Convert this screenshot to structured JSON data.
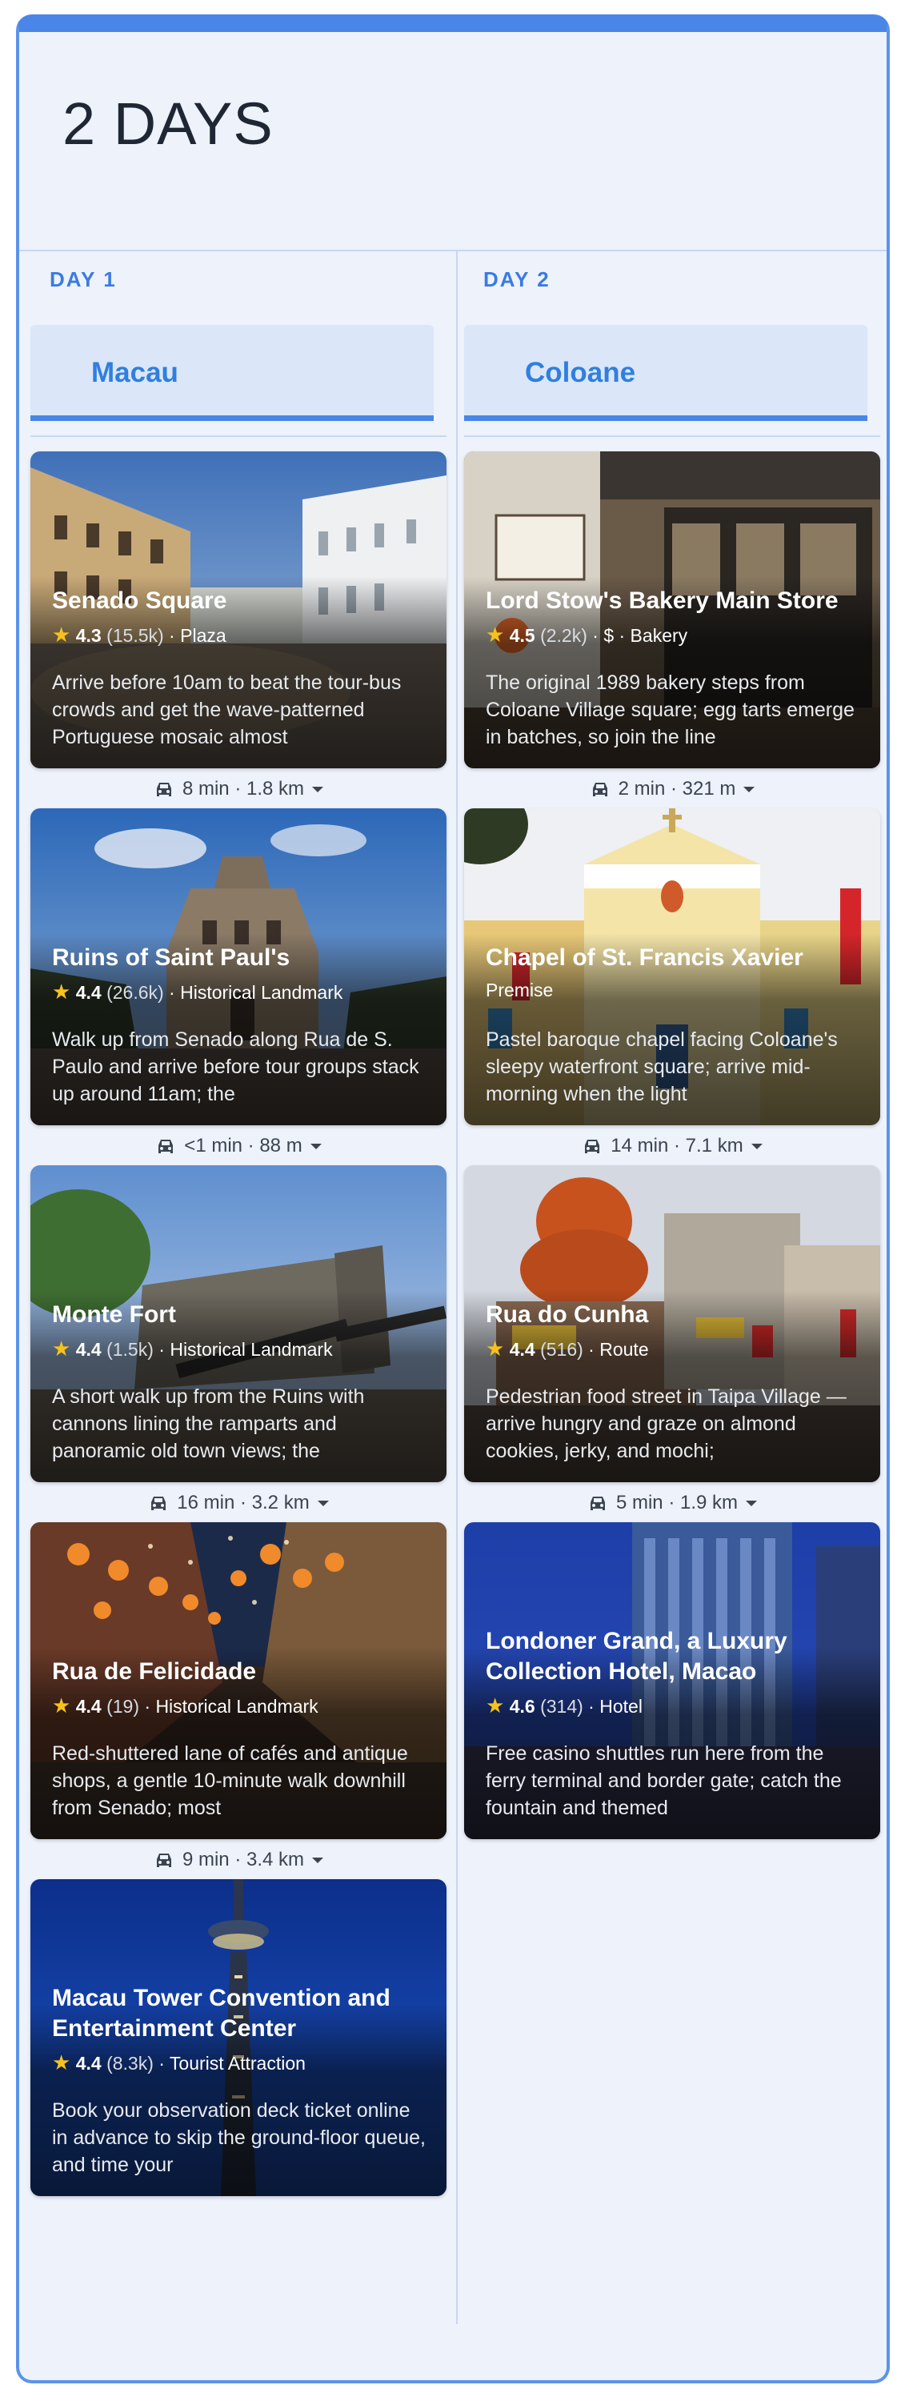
{
  "title": "2 DAYS",
  "days": [
    {
      "label": "DAY 1",
      "location": "Macau",
      "places": [
        {
          "name": "Senado Square",
          "rating": "4.3",
          "count": "(15.5k)",
          "type": "Plaza",
          "desc": "Arrive before 10am to beat the tour-bus crowds and get the wave-patterned Portuguese mosaic almost",
          "travel": "8 min · 1.8 km"
        },
        {
          "name": "Ruins of Saint Paul's",
          "rating": "4.4",
          "count": "(26.6k)",
          "type": "Historical Landmark",
          "desc": "Walk up from Senado along Rua de S. Paulo and arrive before tour groups stack up around 11am; the",
          "travel": "<1 min · 88 m"
        },
        {
          "name": "Monte Fort",
          "rating": "4.4",
          "count": "(1.5k)",
          "type": "Historical Landmark",
          "desc": "A short walk up from the Ruins with cannons lining the ramparts and panoramic old town views; the",
          "travel": "16 min · 3.2 km"
        },
        {
          "name": "Rua de Felicidade",
          "rating": "4.4",
          "count": "(19)",
          "type": "Historical Landmark",
          "desc": "Red-shuttered lane of cafés and antique shops, a gentle 10-minute walk downhill from Senado; most",
          "travel": "9 min · 3.4 km"
        },
        {
          "name": "Macau Tower Convention and Entertainment Center",
          "rating": "4.4",
          "count": "(8.3k)",
          "type": "Tourist Attraction",
          "desc": "Book your observation deck ticket online in advance to skip the ground-floor queue, and time your",
          "travel": ""
        }
      ]
    },
    {
      "label": "DAY 2",
      "location": "Coloane",
      "places": [
        {
          "name": "Lord Stow's Bakery Main Store",
          "rating": "4.5",
          "count": "(2.2k)",
          "type": "$ · Bakery",
          "desc": "The original 1989 bakery steps from Coloane Village square; egg tarts emerge in batches, so join the line",
          "travel": "2 min · 321 m"
        },
        {
          "name": "Chapel of St. Francis Xavier",
          "rating": "",
          "count": "",
          "type": "Premise",
          "desc": "Pastel baroque chapel facing Coloane's sleepy waterfront square; arrive mid-morning when the light",
          "travel": "14 min · 7.1 km"
        },
        {
          "name": "Rua do Cunha",
          "rating": "4.4",
          "count": "(516)",
          "type": "Route",
          "desc": "Pedestrian food street in Taipa Village — arrive hungry and graze on almond cookies, jerky, and mochi;",
          "travel": "5 min · 1.9 km"
        },
        {
          "name": "Londoner Grand, a Luxury Collection Hotel, Macao",
          "rating": "4.6",
          "count": "(314)",
          "type": "Hotel",
          "desc": "Free casino shuttles run here from the ferry terminal and border gate; catch the fountain and themed",
          "travel": ""
        }
      ]
    }
  ],
  "colors": {
    "accent": "#4a86e8",
    "panel": "#edf2fb",
    "star": "#f6c21c"
  }
}
